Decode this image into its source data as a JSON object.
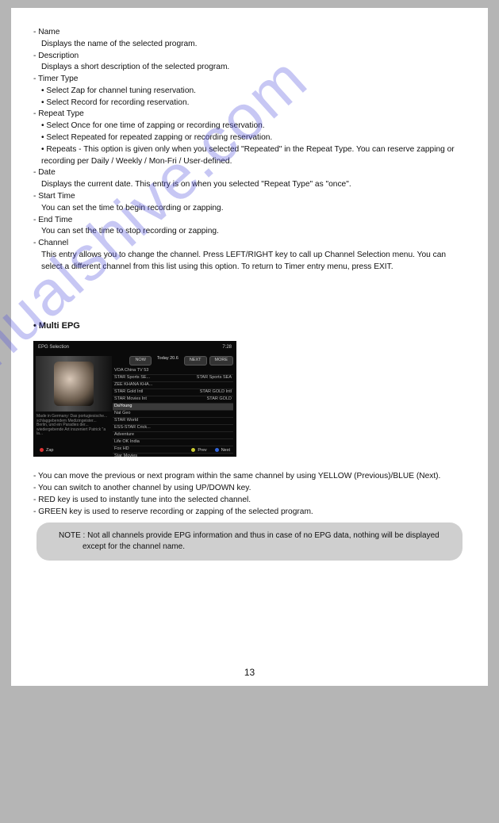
{
  "items": {
    "name": {
      "label": "- Name",
      "desc": "Displays the name of the selected program."
    },
    "description": {
      "label": "- Description",
      "desc": "Displays a short description of the selected program."
    },
    "timerType": {
      "label": "- Timer Type",
      "b1": "• Select Zap for channel tuning reservation.",
      "b2": "• Select Record for recording reservation."
    },
    "repeatType": {
      "label": "- Repeat Type",
      "b1": "• Select Once for one time of zapping or recording reservation.",
      "b2": "• Select Repeated for repeated zapping or recording reservation.",
      "b3": "• Repeats - This option is given only when you selected \"Repeated\" in the Repeat Type. You can reserve zapping or recording per Daily / Weekly / Mon-Fri / User-defined."
    },
    "date": {
      "label": "- Date",
      "desc": "Displays the current date. This entry is on when you selected \"Repeat Type\" as  \"once\"."
    },
    "startTime": {
      "label": "- Start Time",
      "desc": "You can set the time to begin recording or zapping."
    },
    "endTime": {
      "label": "- End Time",
      "desc": "You can set the time to stop recording or zapping."
    },
    "channel": {
      "label": "- Channel",
      "desc": "This entry allows you to change the channel. Press LEFT/RIGHT key to call up Channel Selection menu. You can select a different channel from this list using this option. To return to Timer entry menu, press EXIT."
    }
  },
  "multiEpg": {
    "heading": "• Multi EPG",
    "screenshot": {
      "title": "EPG Selection",
      "time": "7:28",
      "dateLabel": "Today 20.6",
      "btnNow": "NOW",
      "btnNext": "NEXT",
      "btnMore": "MORE",
      "channels": [
        {
          "left": "VOA China TV 53",
          "right": ""
        },
        {
          "left": "STAR Sports SE...",
          "right": "STAR Sports SEA"
        },
        {
          "left": "ZEE KHANA KHA...",
          "right": ""
        },
        {
          "left": "STAR Gold Intl",
          "right": "STAR GOLD Intl"
        },
        {
          "left": "STAR Movies Int",
          "right": "STAR GOLD"
        },
        {
          "left": "DaYoung",
          "right": ""
        },
        {
          "left": "Nat Geo",
          "right": ""
        },
        {
          "left": "STAR World",
          "right": ""
        },
        {
          "left": "ESS-STAR Crick...",
          "right": ""
        },
        {
          "left": "Adventure",
          "right": ""
        },
        {
          "left": "Life OK India",
          "right": ""
        },
        {
          "left": "Fox HD",
          "right": ""
        },
        {
          "left": "Star Movies",
          "right": ""
        }
      ],
      "footer": {
        "zap": "Zap",
        "prev": "Prev",
        "next": "Next"
      }
    },
    "b1": "- You can move the previous or next program within the same channel by using YELLOW (Previous)/BLUE (Next).",
    "b2": "- You can switch to another channel by using UP/DOWN key.",
    "b3": "- RED key is used to instantly tune into the selected channel.",
    "b4": "- GREEN key is used to reserve recording or zapping of the selected program."
  },
  "note": "NOTE :  Not all channels provide EPG information and thus in case of no EPG data, nothing will be displayed except for the channel name.",
  "pageNumber": "13",
  "watermark": "manualshive.com"
}
